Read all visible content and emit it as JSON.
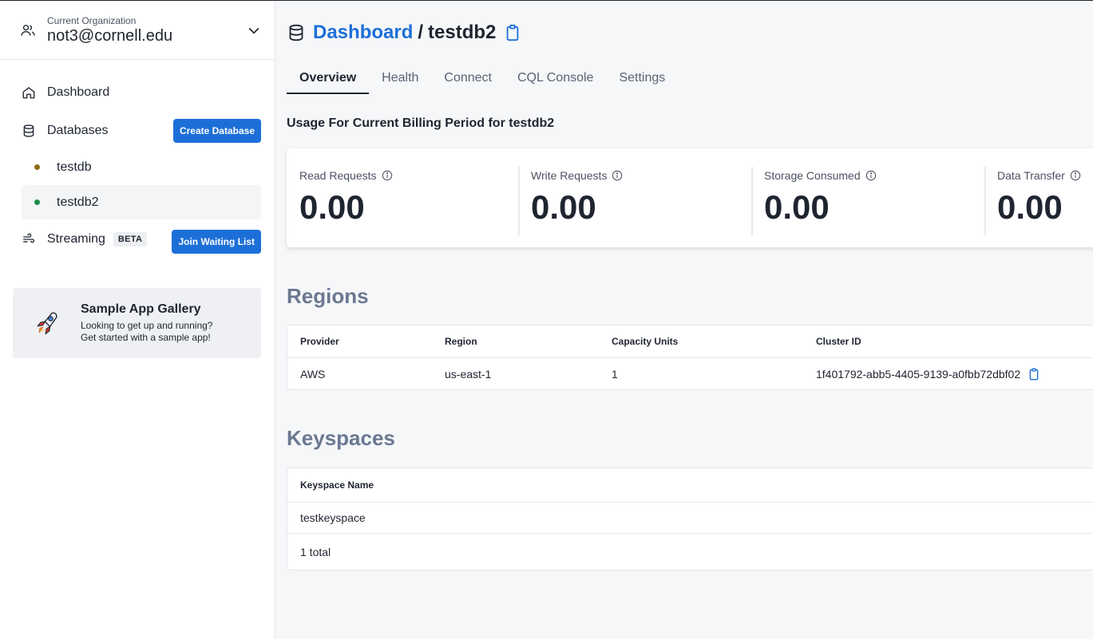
{
  "org": {
    "label": "Current Organization",
    "name": "not3@cornell.edu"
  },
  "nav": {
    "dashboard": "Dashboard",
    "databases": "Databases",
    "create_database": "Create Database",
    "databases_list": [
      {
        "name": "testdb",
        "color": "#8a6d12"
      },
      {
        "name": "testdb2",
        "color": "#1e8a4a"
      }
    ],
    "streaming": "Streaming",
    "beta": "BETA",
    "join_waiting_list": "Join Waiting List"
  },
  "gallery": {
    "title": "Sample App Gallery",
    "line1": "Looking to get up and running?",
    "line2": "Get started with a sample app!"
  },
  "breadcrumb": {
    "root": "Dashboard",
    "separator": "/",
    "current": "testdb2"
  },
  "tabs": [
    "Overview",
    "Health",
    "Connect",
    "CQL Console",
    "Settings"
  ],
  "active_tab": "Overview",
  "usage": {
    "title": "Usage For Current Billing Period for testdb2",
    "metrics": [
      {
        "label": "Read Requests",
        "value": "0.00"
      },
      {
        "label": "Write Requests",
        "value": "0.00"
      },
      {
        "label": "Storage Consumed",
        "value": "0.00"
      },
      {
        "label": "Data Transfer",
        "value": "0.00"
      }
    ]
  },
  "regions": {
    "title": "Regions",
    "columns": [
      "Provider",
      "Region",
      "Capacity Units",
      "Cluster ID"
    ],
    "rows": [
      [
        "AWS",
        "us-east-1",
        "1",
        "1f401792-abb5-4405-9139-a0fbb72dbf02"
      ]
    ]
  },
  "keyspaces": {
    "title": "Keyspaces",
    "columns": [
      "Keyspace Name"
    ],
    "rows": [
      "testkeyspace"
    ],
    "total": "1 total"
  },
  "colors": {
    "accent": "#1d6fd8",
    "section_title": "#6b7891"
  }
}
